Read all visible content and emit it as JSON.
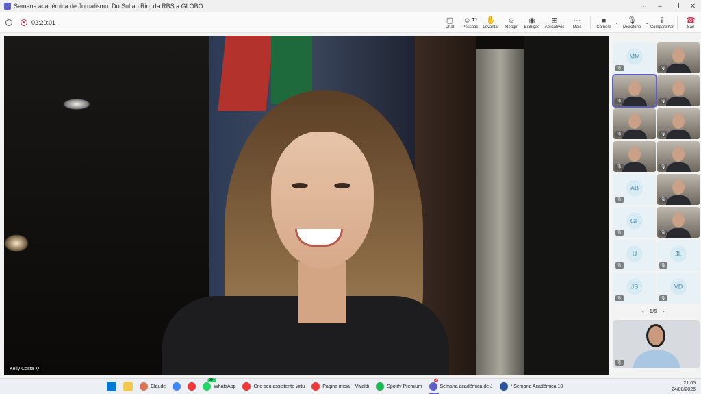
{
  "window": {
    "title": "Semana acadêmica de Jornalismo: Do Sul ao Rio, da RBS a GLOBO"
  },
  "meeting": {
    "elapsed": "02:20:01"
  },
  "toolbar": {
    "chat": "Chat",
    "people": "Pessoas",
    "people_count": "71",
    "raise": "Levantar",
    "react": "Reagir",
    "view": "Exibição",
    "apps": "Aplicativos",
    "more": "Mais",
    "camera": "Câmera",
    "mic": "Microfone",
    "share": "Compartilhar",
    "leave": "Sair"
  },
  "stage": {
    "speaker_name": "Kelly Costa"
  },
  "gallery": {
    "tiles": [
      {
        "kind": "avatar",
        "initials": "MM"
      },
      {
        "kind": "video"
      },
      {
        "kind": "video"
      },
      {
        "kind": "video"
      },
      {
        "kind": "video"
      },
      {
        "kind": "video"
      },
      {
        "kind": "video"
      },
      {
        "kind": "video"
      },
      {
        "kind": "avatar",
        "initials": "AB"
      },
      {
        "kind": "video"
      },
      {
        "kind": "avatar",
        "initials": "GF"
      },
      {
        "kind": "video"
      },
      {
        "kind": "avatar",
        "initials": "U"
      },
      {
        "kind": "avatar",
        "initials": "JL"
      },
      {
        "kind": "avatar",
        "initials": "JS"
      },
      {
        "kind": "avatar",
        "initials": "VD"
      }
    ],
    "page": "1/5"
  },
  "taskbar": {
    "items": [
      {
        "label": "Claude",
        "color": "#d97757"
      },
      {
        "label": "",
        "color": "#4285f4"
      },
      {
        "label": "",
        "color": "#ef3939"
      },
      {
        "label": "WhatsApp",
        "color": "#25d366",
        "badge": "99+"
      },
      {
        "label": "Crie seu assistente virtu",
        "color": "#ef3939"
      },
      {
        "label": "Página inicial - Vivaldi",
        "color": "#ef3939"
      },
      {
        "label": "Spotify Premium",
        "color": "#1db954"
      },
      {
        "label": "Semana acadêmica de J",
        "color": "#5b5fc7",
        "badge": "2"
      },
      {
        "label": "* Semana Acadêmica 10",
        "color": "#2b579a"
      }
    ],
    "time": "21:05",
    "date": "24/08/2026"
  }
}
